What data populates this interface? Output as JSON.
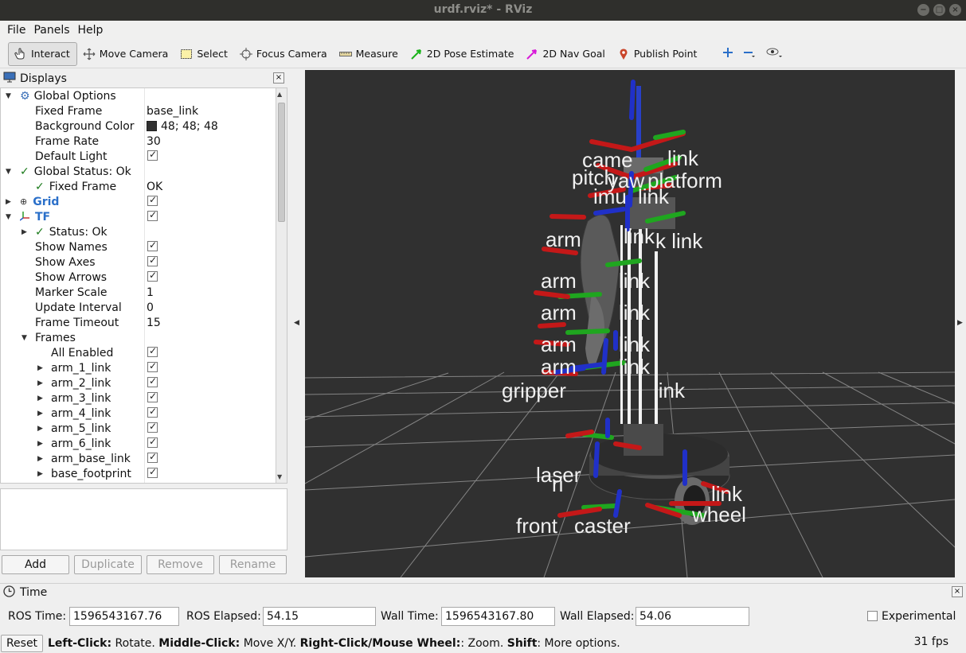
{
  "window": {
    "title": "urdf.rviz* - RViz",
    "buttons": [
      "−",
      "□",
      "×"
    ]
  },
  "menu": [
    "File",
    "Panels",
    "Help"
  ],
  "toolbar": {
    "tools": [
      {
        "label": "Interact",
        "icon": "hand-pointer-icon",
        "active": true
      },
      {
        "label": "Move Camera",
        "icon": "move-arrows-icon"
      },
      {
        "label": "Select",
        "icon": "select-box-icon"
      },
      {
        "label": "Focus Camera",
        "icon": "focus-target-icon"
      },
      {
        "label": "Measure",
        "icon": "ruler-icon"
      },
      {
        "label": "2D Pose Estimate",
        "icon": "green-arrow-icon"
      },
      {
        "label": "2D Nav Goal",
        "icon": "magenta-arrow-icon"
      },
      {
        "label": "Publish Point",
        "icon": "map-pin-icon"
      }
    ]
  },
  "displays": {
    "title": "Displays",
    "rows": [
      {
        "name": "Global Options",
        "value": ""
      },
      {
        "name": "Fixed Frame",
        "value": "base_link"
      },
      {
        "name": "Background Color",
        "value": "48; 48; 48"
      },
      {
        "name": "Frame Rate",
        "value": "30"
      },
      {
        "name": "Default Light",
        "value": ""
      },
      {
        "name": "Global Status: Ok",
        "value": ""
      },
      {
        "name": "Fixed Frame",
        "value": "OK"
      },
      {
        "name": "Grid",
        "value": ""
      },
      {
        "name": "TF",
        "value": ""
      },
      {
        "name": "Status: Ok",
        "value": ""
      },
      {
        "name": "Show Names",
        "value": ""
      },
      {
        "name": "Show Axes",
        "value": ""
      },
      {
        "name": "Show Arrows",
        "value": ""
      },
      {
        "name": "Marker Scale",
        "value": "1"
      },
      {
        "name": "Update Interval",
        "value": "0"
      },
      {
        "name": "Frame Timeout",
        "value": "15"
      },
      {
        "name": "Frames",
        "value": ""
      },
      {
        "name": "All Enabled",
        "value": ""
      },
      {
        "name": "arm_1_link",
        "value": ""
      },
      {
        "name": "arm_2_link",
        "value": ""
      },
      {
        "name": "arm_3_link",
        "value": ""
      },
      {
        "name": "arm_4_link",
        "value": ""
      },
      {
        "name": "arm_5_link",
        "value": ""
      },
      {
        "name": "arm_6_link",
        "value": ""
      },
      {
        "name": "arm_base_link",
        "value": ""
      },
      {
        "name": "base_footprint",
        "value": ""
      }
    ],
    "buttons": {
      "add": "Add",
      "duplicate": "Duplicate",
      "remove": "Remove",
      "rename": "Rename"
    }
  },
  "scene": {
    "background": "#303030",
    "frame_labels": [
      "came",
      "link",
      "pitch",
      "yaw",
      "platform",
      "imu",
      "link",
      "arm",
      "link",
      "k link",
      "arm",
      "link",
      "arm",
      "link",
      "arm",
      "link",
      "arm",
      "link",
      "gripper",
      "link",
      "laser",
      "ri",
      "link",
      "front",
      "caster",
      "wheel"
    ]
  },
  "time": {
    "title": "Time",
    "ros_time_label": "ROS Time:",
    "ros_time": "1596543167.76",
    "ros_elapsed_label": "ROS Elapsed:",
    "ros_elapsed": "54.15",
    "wall_time_label": "Wall Time:",
    "wall_time": "1596543167.80",
    "wall_elapsed_label": "Wall Elapsed:",
    "wall_elapsed": "54.06",
    "experimental_label": "Experimental"
  },
  "status": {
    "reset": "Reset",
    "left_click_key": "Left-Click:",
    "left_click": " Rotate. ",
    "middle_click_key": "Middle-Click:",
    "middle_click": " Move X/Y. ",
    "right_click_key": "Right-Click/Mouse Wheel:",
    "right_click": ": Zoom. ",
    "shift_key": "Shift",
    "shift": ": More options.",
    "fps": "31 fps"
  }
}
